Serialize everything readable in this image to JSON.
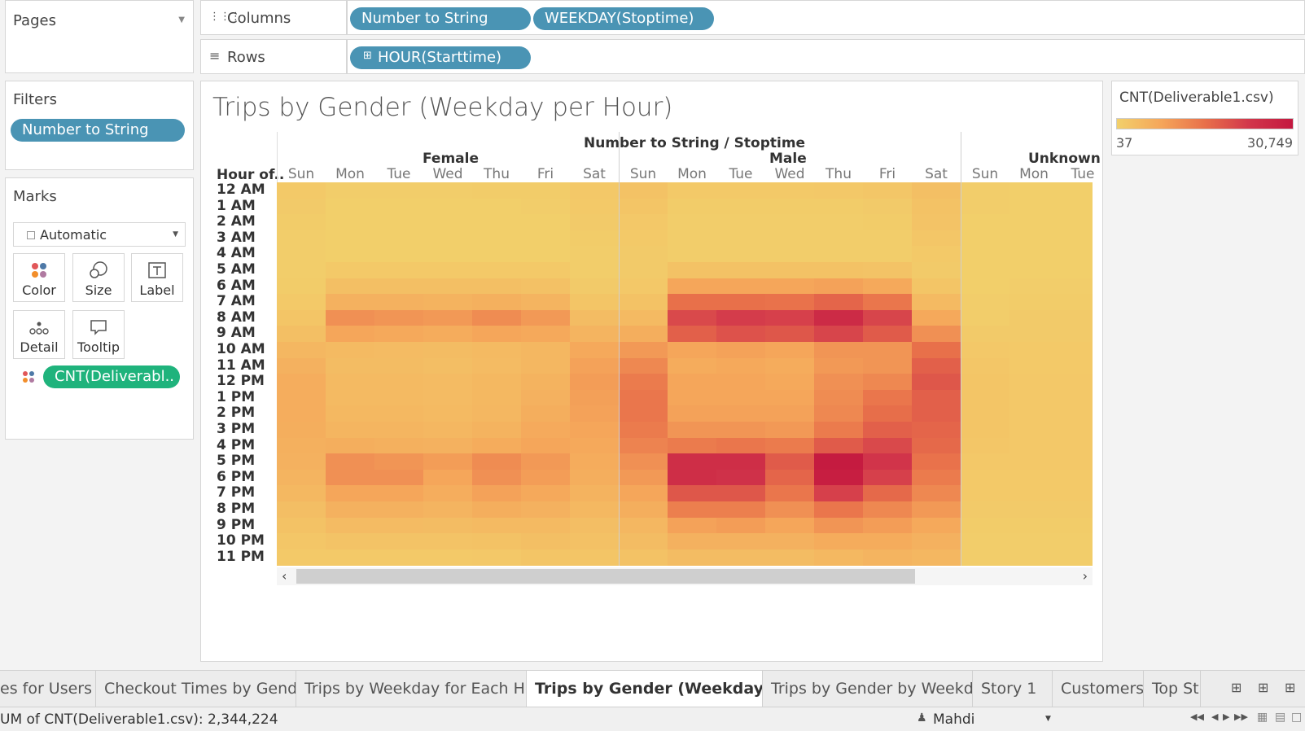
{
  "pages_panel": {
    "title": "Pages"
  },
  "filters_panel": {
    "title": "Filters",
    "pill": "Number to String"
  },
  "marks_panel": {
    "title": "Marks",
    "mark_type": "Automatic",
    "cards": [
      "Color",
      "Size",
      "Label",
      "Detail",
      "Tooltip"
    ],
    "field_pill": "CNT(Deliverabl.."
  },
  "shelves": {
    "columns_label": "Columns",
    "rows_label": "Rows",
    "columns_pills": [
      "Number to String",
      "WEEKDAY(Stoptime)"
    ],
    "rows_pills": [
      "HOUR(Starttime)"
    ]
  },
  "viz": {
    "title": "Trips by Gender (Weekday per Hour)",
    "top_header": "Number to String  /  Stoptime",
    "row_header": "Hour of..",
    "groups": [
      "Female",
      "Male",
      "Unknown"
    ],
    "days": [
      "Sun",
      "Mon",
      "Tue",
      "Wed",
      "Thu",
      "Fri",
      "Sat"
    ],
    "unknown_days_visible": [
      "Sun",
      "Mon",
      "Tue"
    ],
    "hours": [
      "12 AM",
      "1 AM",
      "2 AM",
      "3 AM",
      "4 AM",
      "5 AM",
      "6 AM",
      "7 AM",
      "8 AM",
      "9 AM",
      "10 AM",
      "11 AM",
      "12 PM",
      "1 PM",
      "2 PM",
      "3 PM",
      "4 PM",
      "5 PM",
      "6 PM",
      "7 PM",
      "8 PM",
      "9 PM",
      "10 PM",
      "11 PM"
    ]
  },
  "legend": {
    "title": "CNT(Deliverable1.csv)",
    "min_label": "37",
    "max_label": "30,749",
    "min": 37,
    "max": 30749,
    "color_low": "#f2d06b",
    "color_high": "#c4183f"
  },
  "chart_data": {
    "type": "heatmap",
    "title": "Trips by Gender (Weekday per Hour)",
    "columns_label": "Number to String / Stoptime",
    "row_label": "Hour of..",
    "value_range": [
      37,
      30749
    ],
    "female": [
      [
        0.05,
        0.02,
        0.02,
        0.02,
        0.03,
        0.03,
        0.06
      ],
      [
        0.04,
        0.01,
        0.01,
        0.01,
        0.01,
        0.02,
        0.05
      ],
      [
        0.03,
        0.01,
        0.01,
        0.01,
        0.01,
        0.01,
        0.04
      ],
      [
        0.02,
        0.01,
        0.01,
        0.01,
        0.01,
        0.01,
        0.03
      ],
      [
        0.02,
        0.01,
        0.01,
        0.01,
        0.01,
        0.01,
        0.02
      ],
      [
        0.02,
        0.05,
        0.05,
        0.05,
        0.05,
        0.05,
        0.02
      ],
      [
        0.03,
        0.12,
        0.12,
        0.12,
        0.12,
        0.11,
        0.04
      ],
      [
        0.05,
        0.22,
        0.22,
        0.21,
        0.23,
        0.2,
        0.08
      ],
      [
        0.08,
        0.4,
        0.38,
        0.36,
        0.42,
        0.36,
        0.14
      ],
      [
        0.12,
        0.3,
        0.28,
        0.26,
        0.3,
        0.28,
        0.2
      ],
      [
        0.18,
        0.16,
        0.15,
        0.14,
        0.16,
        0.18,
        0.28
      ],
      [
        0.22,
        0.14,
        0.14,
        0.13,
        0.15,
        0.18,
        0.32
      ],
      [
        0.25,
        0.16,
        0.16,
        0.15,
        0.17,
        0.21,
        0.34
      ],
      [
        0.25,
        0.16,
        0.16,
        0.15,
        0.17,
        0.22,
        0.33
      ],
      [
        0.25,
        0.17,
        0.17,
        0.16,
        0.18,
        0.24,
        0.32
      ],
      [
        0.24,
        0.19,
        0.19,
        0.18,
        0.21,
        0.27,
        0.3
      ],
      [
        0.23,
        0.24,
        0.23,
        0.22,
        0.26,
        0.3,
        0.28
      ],
      [
        0.22,
        0.4,
        0.38,
        0.34,
        0.42,
        0.36,
        0.26
      ],
      [
        0.2,
        0.4,
        0.4,
        0.3,
        0.4,
        0.34,
        0.24
      ],
      [
        0.17,
        0.3,
        0.3,
        0.25,
        0.32,
        0.28,
        0.21
      ],
      [
        0.13,
        0.22,
        0.22,
        0.2,
        0.24,
        0.22,
        0.17
      ],
      [
        0.1,
        0.15,
        0.15,
        0.14,
        0.16,
        0.16,
        0.13
      ],
      [
        0.07,
        0.09,
        0.09,
        0.09,
        0.1,
        0.12,
        0.11
      ],
      [
        0.05,
        0.05,
        0.05,
        0.05,
        0.06,
        0.08,
        0.08
      ]
    ],
    "male": [
      [
        0.1,
        0.05,
        0.05,
        0.05,
        0.06,
        0.07,
        0.12
      ],
      [
        0.08,
        0.03,
        0.03,
        0.03,
        0.03,
        0.04,
        0.1
      ],
      [
        0.06,
        0.02,
        0.02,
        0.02,
        0.02,
        0.03,
        0.09
      ],
      [
        0.05,
        0.02,
        0.02,
        0.02,
        0.02,
        0.02,
        0.07
      ],
      [
        0.04,
        0.02,
        0.02,
        0.02,
        0.02,
        0.02,
        0.05
      ],
      [
        0.04,
        0.1,
        0.1,
        0.1,
        0.1,
        0.09,
        0.04
      ],
      [
        0.06,
        0.3,
        0.3,
        0.3,
        0.32,
        0.28,
        0.08
      ],
      [
        0.1,
        0.55,
        0.55,
        0.54,
        0.6,
        0.52,
        0.16
      ],
      [
        0.16,
        0.72,
        0.78,
        0.76,
        0.88,
        0.74,
        0.28
      ],
      [
        0.24,
        0.62,
        0.68,
        0.66,
        0.74,
        0.64,
        0.4
      ],
      [
        0.36,
        0.3,
        0.32,
        0.3,
        0.38,
        0.38,
        0.55
      ],
      [
        0.44,
        0.26,
        0.28,
        0.26,
        0.36,
        0.38,
        0.62
      ],
      [
        0.5,
        0.3,
        0.3,
        0.28,
        0.4,
        0.44,
        0.66
      ],
      [
        0.52,
        0.3,
        0.3,
        0.3,
        0.42,
        0.52,
        0.62
      ],
      [
        0.52,
        0.32,
        0.32,
        0.32,
        0.44,
        0.56,
        0.62
      ],
      [
        0.5,
        0.38,
        0.38,
        0.36,
        0.5,
        0.62,
        0.6
      ],
      [
        0.46,
        0.5,
        0.52,
        0.5,
        0.64,
        0.72,
        0.58
      ],
      [
        0.4,
        0.86,
        0.86,
        0.64,
        0.98,
        0.82,
        0.54
      ],
      [
        0.36,
        0.86,
        0.84,
        0.6,
        0.96,
        0.76,
        0.5
      ],
      [
        0.3,
        0.66,
        0.66,
        0.52,
        0.76,
        0.58,
        0.44
      ],
      [
        0.24,
        0.48,
        0.48,
        0.4,
        0.52,
        0.44,
        0.36
      ],
      [
        0.18,
        0.32,
        0.34,
        0.3,
        0.38,
        0.34,
        0.28
      ],
      [
        0.14,
        0.22,
        0.22,
        0.22,
        0.26,
        0.26,
        0.22
      ],
      [
        0.1,
        0.14,
        0.14,
        0.14,
        0.17,
        0.2,
        0.18
      ]
    ],
    "unknown": [
      [
        0.02,
        0.01,
        0.01
      ],
      [
        0.02,
        0.01,
        0.01
      ],
      [
        0.01,
        0.01,
        0.01
      ],
      [
        0.01,
        0.01,
        0.01
      ],
      [
        0.01,
        0.01,
        0.01
      ],
      [
        0.01,
        0.01,
        0.01
      ],
      [
        0.01,
        0.02,
        0.02
      ],
      [
        0.02,
        0.03,
        0.03
      ],
      [
        0.02,
        0.04,
        0.04
      ],
      [
        0.04,
        0.04,
        0.04
      ],
      [
        0.06,
        0.05,
        0.05
      ],
      [
        0.07,
        0.05,
        0.05
      ],
      [
        0.08,
        0.06,
        0.06
      ],
      [
        0.08,
        0.06,
        0.06
      ],
      [
        0.08,
        0.06,
        0.06
      ],
      [
        0.08,
        0.06,
        0.06
      ],
      [
        0.07,
        0.06,
        0.06
      ],
      [
        0.06,
        0.06,
        0.06
      ],
      [
        0.05,
        0.05,
        0.05
      ],
      [
        0.05,
        0.05,
        0.05
      ],
      [
        0.04,
        0.04,
        0.04
      ],
      [
        0.03,
        0.03,
        0.03
      ],
      [
        0.02,
        0.02,
        0.02
      ],
      [
        0.02,
        0.02,
        0.02
      ]
    ]
  },
  "tabs": [
    {
      "label": "es for Users",
      "active": false
    },
    {
      "label": "Checkout Times by Gender",
      "active": false
    },
    {
      "label": "Trips by Weekday for Each Hour",
      "active": false
    },
    {
      "label": "Trips by Gender (Weekday per ...",
      "active": true
    },
    {
      "label": "Trips by Gender by Weekday",
      "active": false
    },
    {
      "label": "Story 1",
      "active": false
    },
    {
      "label": "Customers",
      "active": false
    },
    {
      "label": "Top St",
      "active": false
    }
  ],
  "status": {
    "summary": "UM of CNT(Deliverable1.csv): 2,344,224",
    "user": "Mahdi"
  }
}
